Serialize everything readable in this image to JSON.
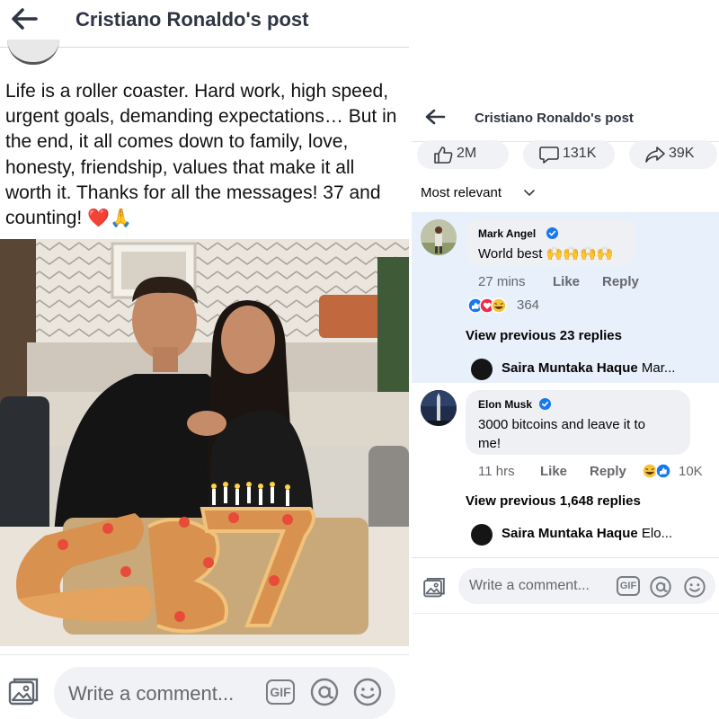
{
  "left": {
    "header": {
      "title": "Cristiano Ronaldo's post"
    },
    "post_text": "Life is a roller coaster. Hard work, high speed, urgent goals, demanding expectations… But in the end, it all comes down to family, love, honesty, friendship, values that make it all worth it. Thanks for all the messages! 37 and counting!",
    "post_emojis": "❤️🙏",
    "composer": {
      "placeholder": "Write a comment...",
      "gif_label": "GIF"
    }
  },
  "right": {
    "header": {
      "title": "Cristiano Ronaldo's post"
    },
    "stats": {
      "likes": "2M",
      "comments": "131K",
      "shares": "39K"
    },
    "sort_label": "Most relevant",
    "comments": [
      {
        "author": "Mark Angel",
        "text": "World best 🙌🙌🙌🙌",
        "time": "27 mins",
        "like_label": "Like",
        "reply_label": "Reply",
        "reactions_count": "364",
        "view_previous": "View previous 23 replies",
        "latest_reply": {
          "author": "Saira Muntaka Haque",
          "snippet": "Mar..."
        }
      },
      {
        "author": "Elon Musk",
        "text_line1": "3000 bitcoins and leave it to",
        "text_line2": "me!",
        "time": "11 hrs",
        "like_label": "Like",
        "reply_label": "Reply",
        "reactions_count": "10K",
        "view_previous": "View previous 1,648 replies",
        "latest_reply": {
          "author": "Saira Muntaka Haque",
          "snippet": "Elo..."
        }
      }
    ],
    "composer": {
      "placeholder": "Write a comment...",
      "gif_label": "GIF"
    }
  },
  "colors": {
    "facebook_blue": "#1877f2",
    "highlight_bg": "#e8f0fb",
    "bubble_bg": "#eef0f3",
    "meta_gray": "#65676b",
    "heart_red": "#e0212e"
  }
}
